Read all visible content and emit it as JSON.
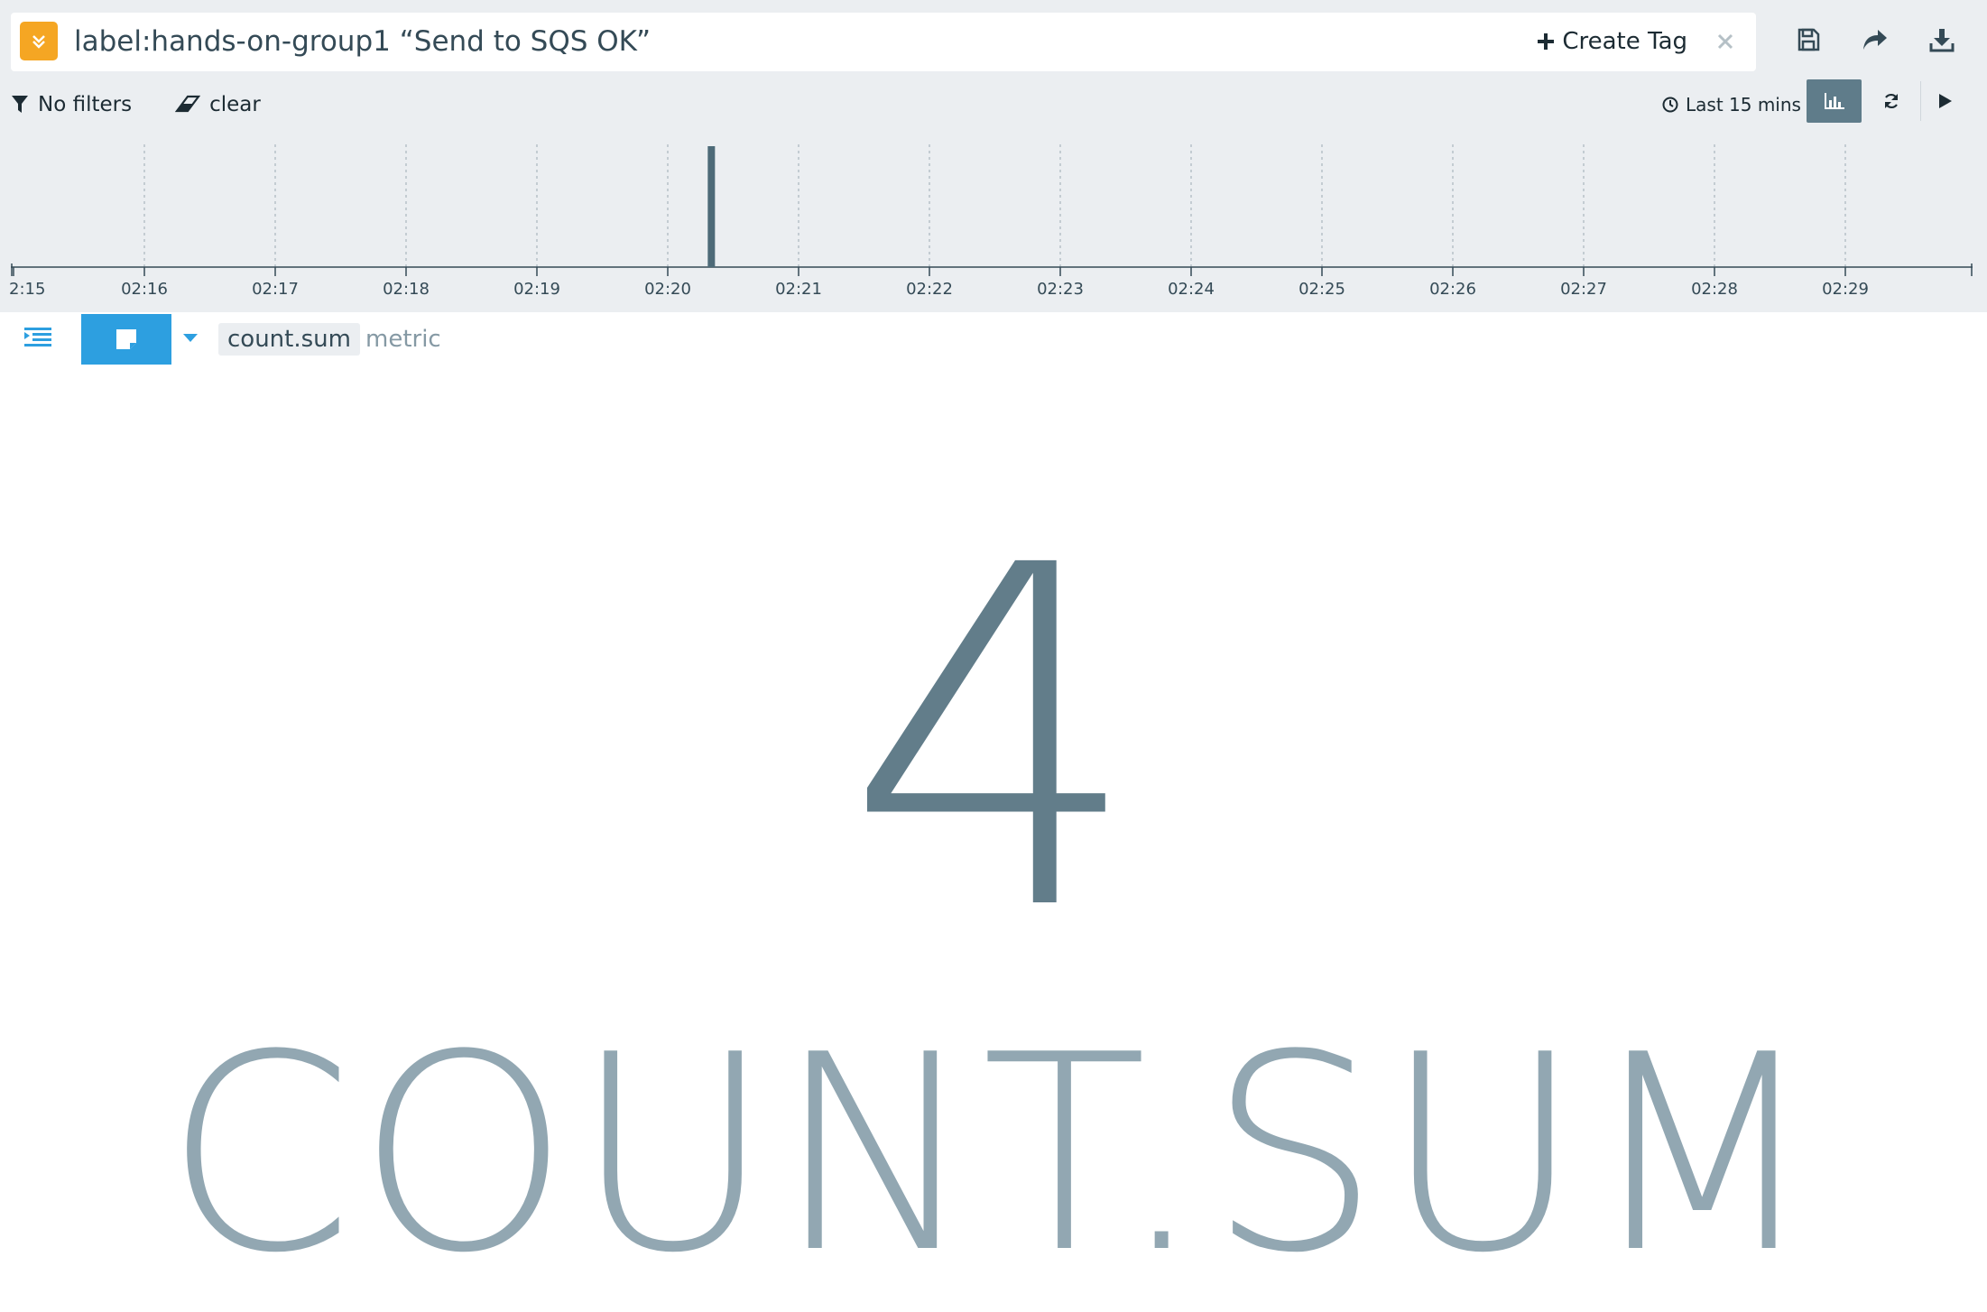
{
  "query": {
    "text": "label:hands-on-group1 “Send to SQS OK”",
    "create_tag_label": "Create Tag"
  },
  "icons": {
    "query_toggle": "chevron-double-down-icon",
    "create_tag": "plus-icon",
    "close": "close-icon",
    "save": "save-icon",
    "share": "share-icon",
    "download": "download-icon",
    "filter": "filter-icon",
    "clear": "eraser-icon",
    "clock": "clock-icon",
    "histogram": "bar-chart-icon",
    "refresh": "refresh-icon",
    "play": "play-icon",
    "outline": "indent-list-icon",
    "viz_type": "metric-tile-icon",
    "caret": "caret-down-icon"
  },
  "filters": {
    "no_filters_label": "No filters",
    "clear_label": "clear"
  },
  "time": {
    "range_label": "Last 15 mins"
  },
  "chart_data": {
    "type": "bar",
    "x_tick_labels": [
      "2:15",
      "02:16",
      "02:17",
      "02:18",
      "02:19",
      "02:20",
      "02:21",
      "02:22",
      "02:23",
      "02:24",
      "02:25",
      "02:26",
      "02:27",
      "02:28",
      "02:29"
    ],
    "series": [
      {
        "x": [
          "02:20:20"
        ],
        "values": [
          4
        ]
      }
    ],
    "grid": true
  },
  "visualization": {
    "metric_field": "count.sum",
    "metric_type": "metric",
    "value": "4",
    "label": "COUNT.SUM"
  },
  "colors": {
    "accent_orange": "#f5a623",
    "accent_blue": "#2d9fe0",
    "value_color": "#627d8a",
    "label_color": "#92a7b2"
  }
}
